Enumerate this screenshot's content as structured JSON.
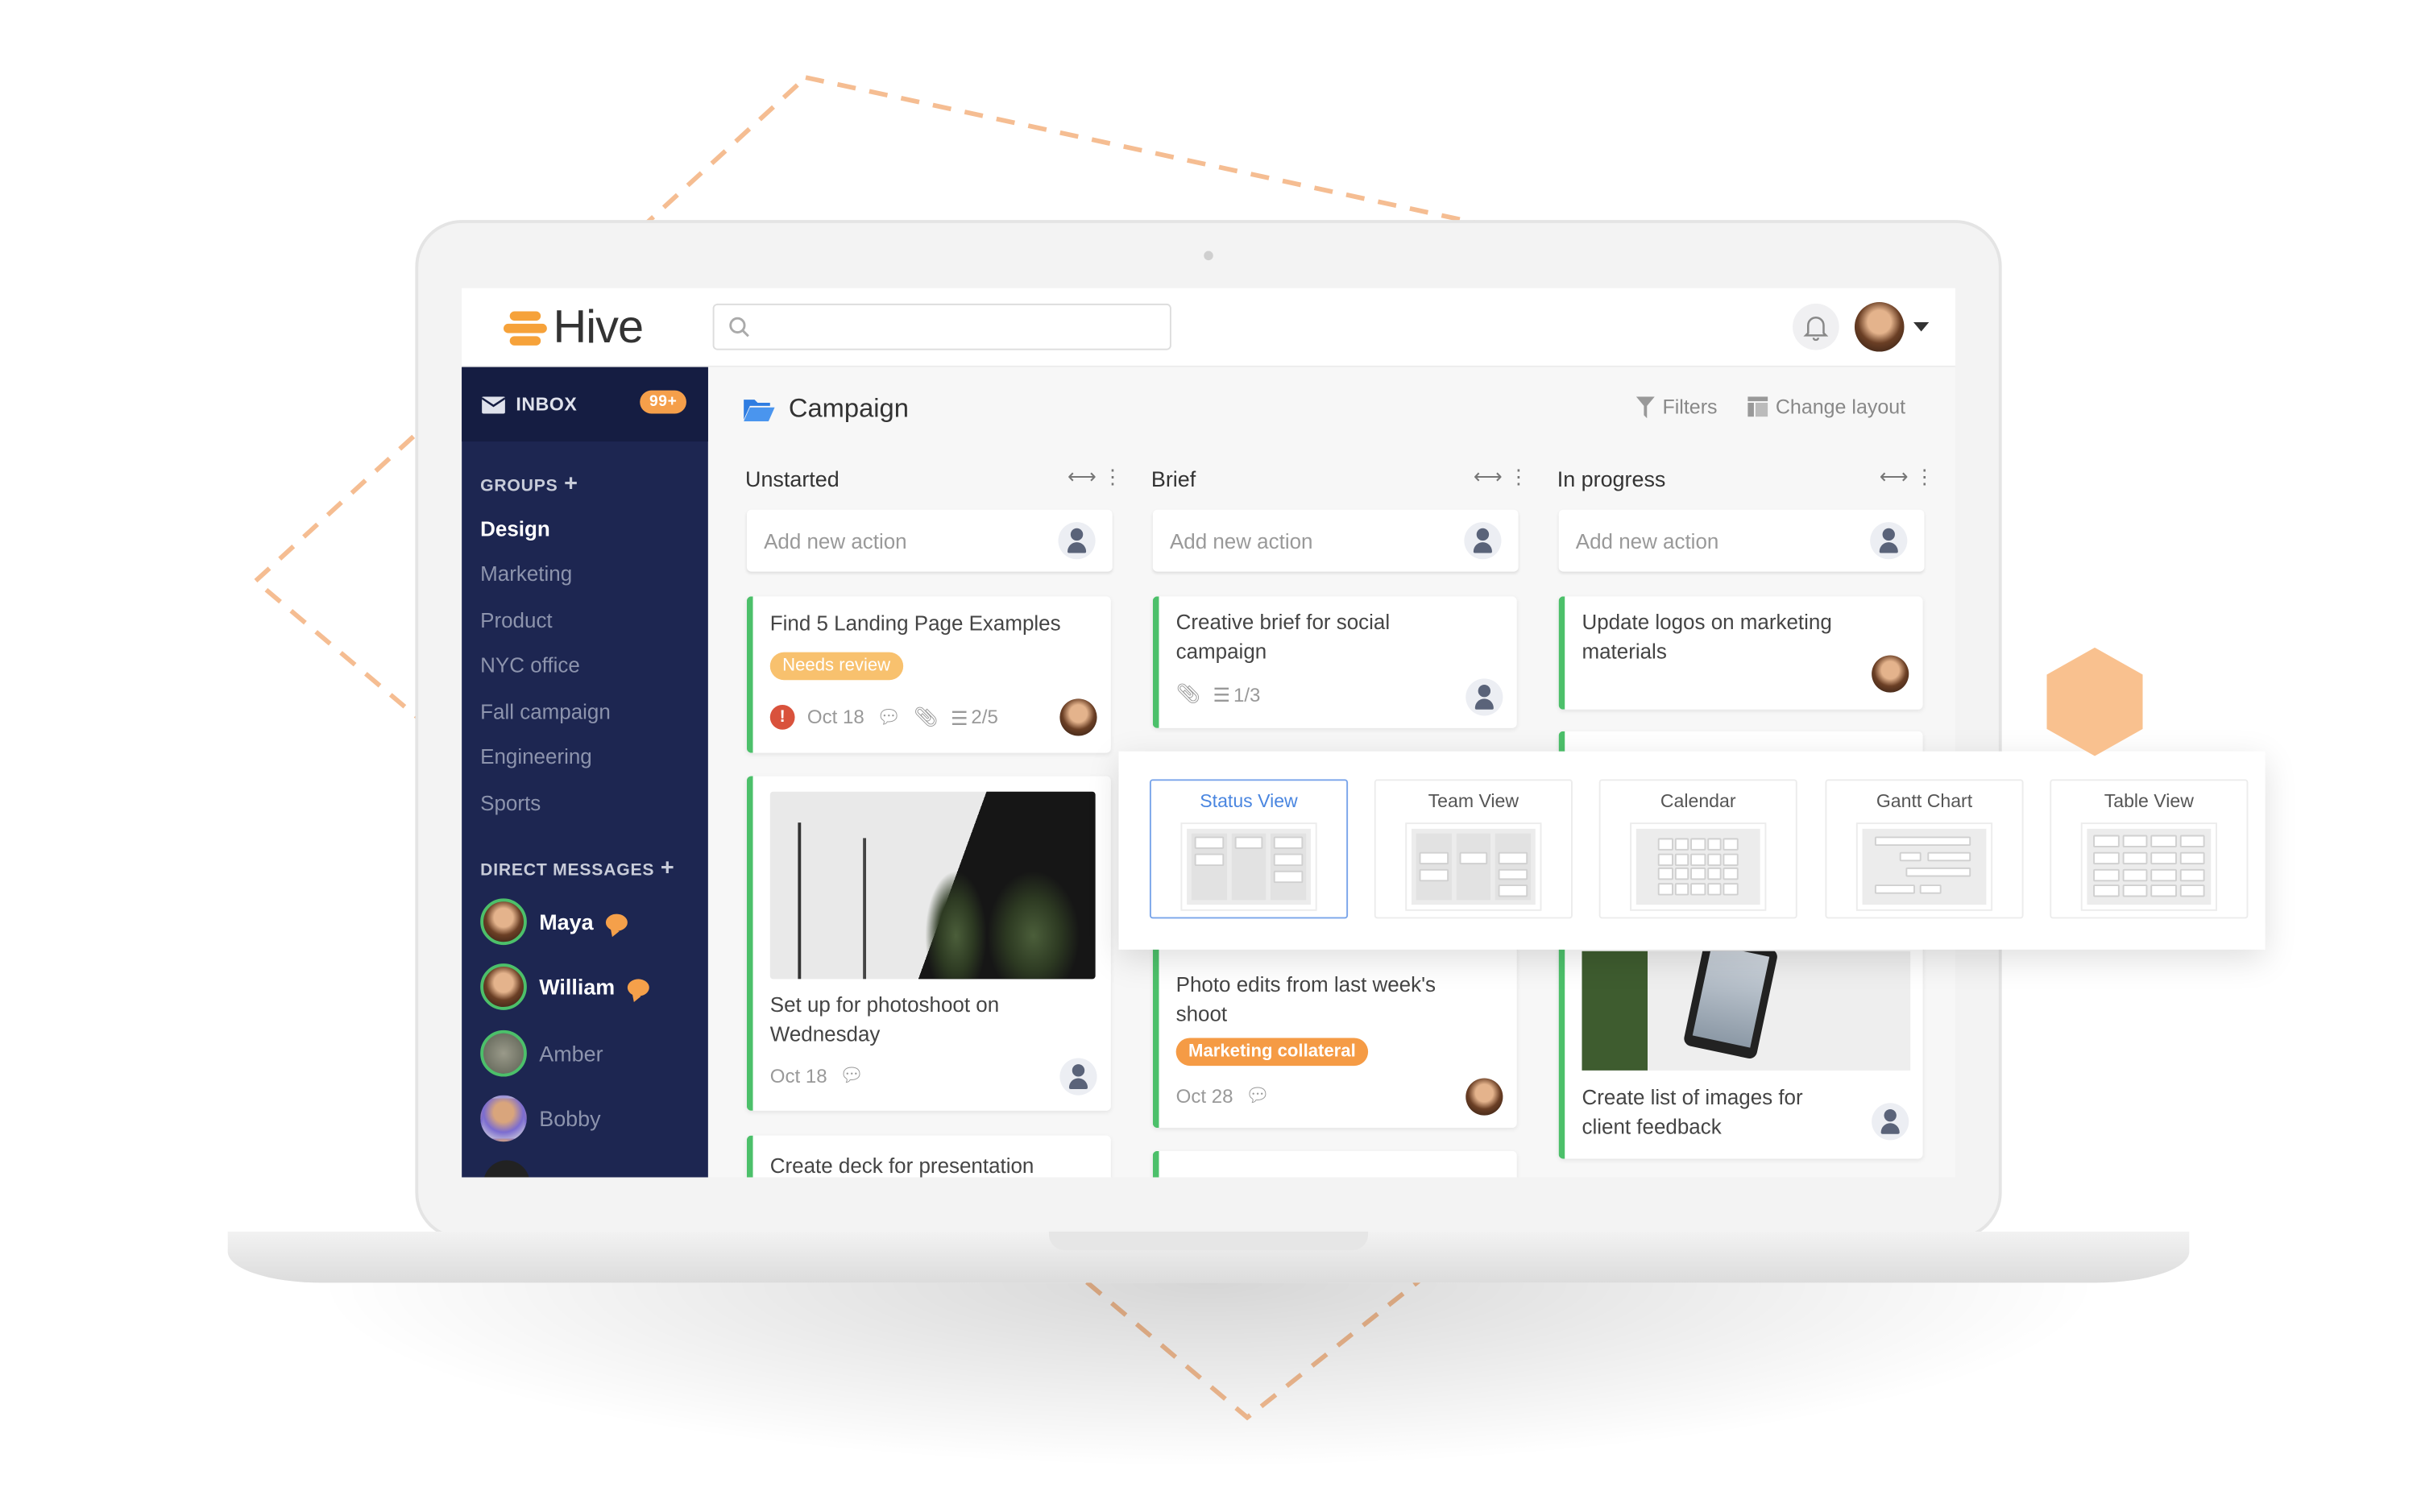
{
  "app": {
    "logo_text": "Hive",
    "brand_color": "#f6a23a",
    "accent_color": "#4cc06a"
  },
  "header": {
    "search_placeholder": "",
    "search_icon": "search-icon",
    "bell_icon": "bell-icon",
    "avatar_icon": "user-avatar"
  },
  "sidebar": {
    "inbox_label": "INBOX",
    "inbox_badge": "99+",
    "groups_label": "GROUPS",
    "groups": [
      {
        "label": "Design",
        "active": true
      },
      {
        "label": "Marketing"
      },
      {
        "label": "Product"
      },
      {
        "label": "NYC office"
      },
      {
        "label": "Fall campaign"
      },
      {
        "label": "Engineering"
      },
      {
        "label": "Sports"
      }
    ],
    "dm_label": "DIRECT MESSAGES",
    "dms": [
      {
        "name": "Maya",
        "unread": true
      },
      {
        "name": "William",
        "unread": true
      },
      {
        "name": "Amber",
        "unread": false
      },
      {
        "name": "Bobby",
        "unread": false
      }
    ]
  },
  "main": {
    "title": "Campaign",
    "filters_label": "Filters",
    "change_layout_label": "Change layout",
    "add_action_placeholder": "Add new action",
    "columns": [
      {
        "title": "Unstarted",
        "cards": [
          {
            "title": "Find 5 Landing Page Examples",
            "tag": "Needs review",
            "date": "Oct 18",
            "checklist": "2/5",
            "overdue": true
          },
          {
            "title": "Set up for photoshoot on Wednesday",
            "date": "Oct 18"
          },
          {
            "title": "Create deck for presentation"
          }
        ]
      },
      {
        "title": "Brief",
        "cards": [
          {
            "title": "Creative brief for social campaign",
            "checklist": "1/3"
          },
          {
            "title": "Photo edits from last week's shoot",
            "tag": "Marketing collateral",
            "date": "Oct 28"
          }
        ]
      },
      {
        "title": "In progress",
        "cards": [
          {
            "title": "Update logos on marketing materials"
          },
          {
            "title": "Create list of images for client feedback"
          }
        ]
      }
    ]
  },
  "layout_picker": {
    "options": [
      {
        "label": "Status View",
        "selected": true
      },
      {
        "label": "Team View"
      },
      {
        "label": "Calendar"
      },
      {
        "label": "Gantt Chart"
      },
      {
        "label": "Table View"
      }
    ]
  },
  "colors": {
    "sidebar": "#1d2651",
    "tag_review": "#f8c16e",
    "tag_marketing": "#f59b45",
    "selected_view": "#4a86e0"
  }
}
